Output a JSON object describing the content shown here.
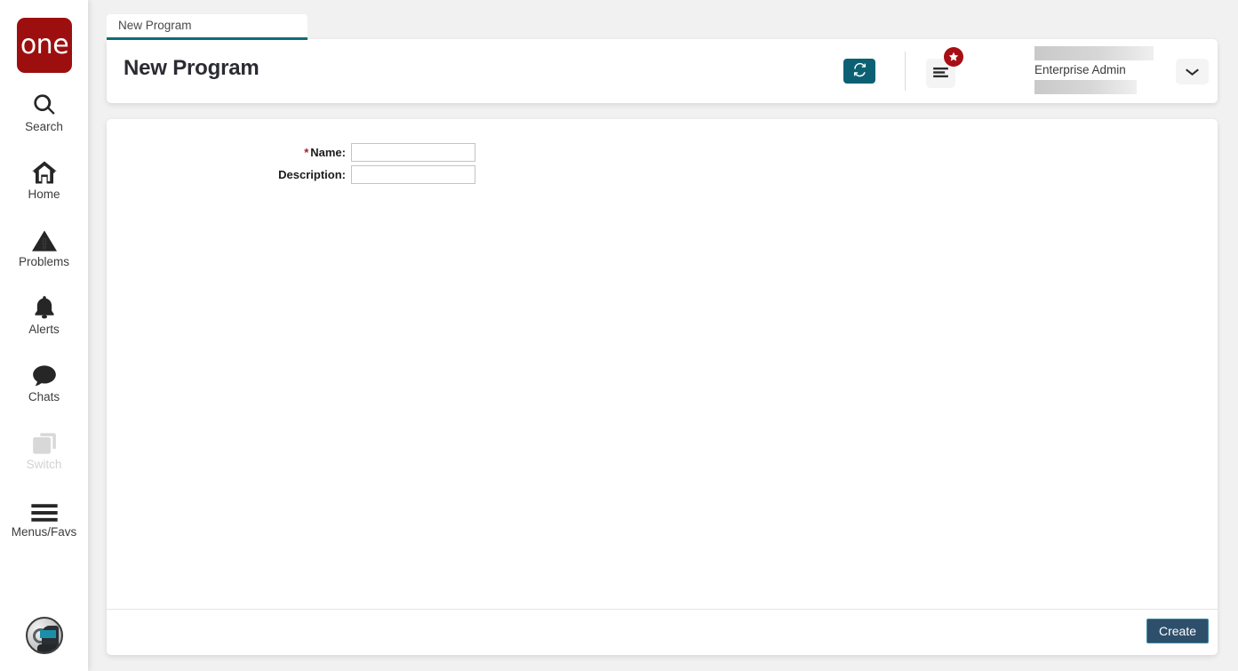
{
  "window": {
    "title": "New Program",
    "background_color": "#f1f1f1"
  },
  "sidebar": {
    "logo": {
      "text": "one",
      "color": "#9d0f0f"
    },
    "items": [
      {
        "label": "Search",
        "icon": "search-icon",
        "disabled": false
      },
      {
        "label": "Home",
        "icon": "home-icon",
        "disabled": false
      },
      {
        "label": "Problems",
        "icon": "warning-icon",
        "disabled": false
      },
      {
        "label": "Alerts",
        "icon": "bell-icon",
        "disabled": false
      },
      {
        "label": "Chats",
        "icon": "chat-icon",
        "disabled": false
      },
      {
        "label": "Switch",
        "icon": "switch-icon",
        "disabled": true
      },
      {
        "label": "Menus/Favs",
        "icon": "hamburger-icon",
        "disabled": false
      }
    ],
    "avatar": {
      "name": "avatar"
    }
  },
  "tab": {
    "label": "New Program",
    "active_color": "#126a77"
  },
  "header": {
    "title": "New Program",
    "refresh_button": {
      "icon": "refresh-icon",
      "color": "#0b6173"
    },
    "menu_fav_button": {
      "icon": "hamburger-icon",
      "badge_icon": "star-icon",
      "badge_color": "#a70f15"
    },
    "user": {
      "name_redacted": "",
      "role": "Enterprise Admin",
      "org_redacted": ""
    },
    "dropdown_button": {
      "icon": "chevron-down-icon"
    }
  },
  "form": {
    "fields": [
      {
        "label": "Name:",
        "required": true,
        "required_marker": "*",
        "value": "",
        "placeholder": ""
      },
      {
        "label": "Description:",
        "required": false,
        "required_marker": "",
        "value": "",
        "placeholder": ""
      }
    ]
  },
  "footer": {
    "create_label": "Create"
  }
}
